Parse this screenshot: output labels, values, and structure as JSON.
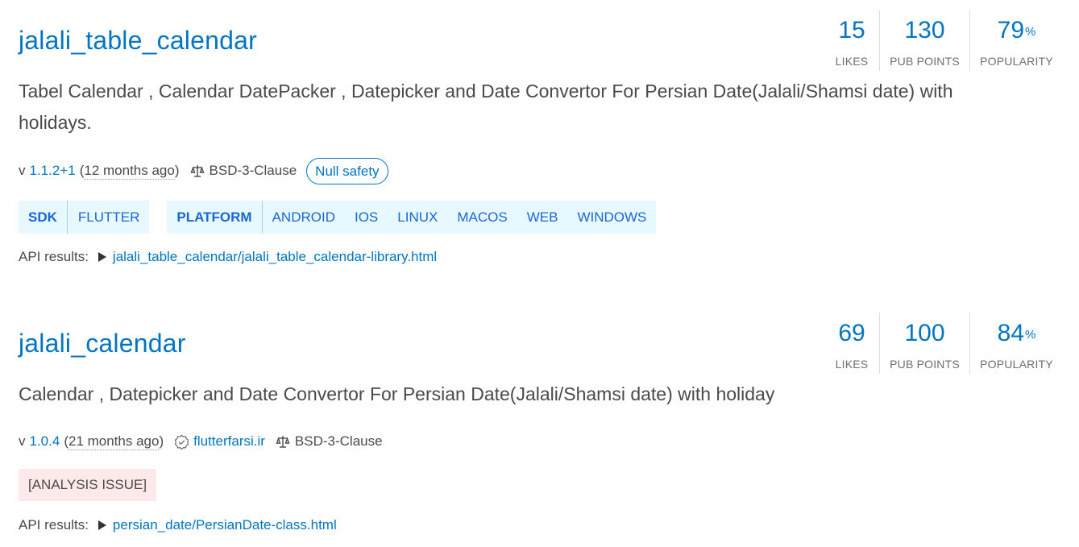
{
  "packages": [
    {
      "name": "jalali_table_calendar",
      "likes": "15",
      "points": "130",
      "popularity": "79",
      "likes_label": "LIKES",
      "points_label": "PUB POINTS",
      "popularity_label": "POPULARITY",
      "pct_symbol": "%",
      "description": "Tabel Calendar , Calendar DatePacker , Datepicker and Date Convertor For Persian Date(Jalali/Shamsi date) with holidays.",
      "version_prefix": "v",
      "version": "1.1.2+1",
      "ago": "12 months ago",
      "license": "BSD-3-Clause",
      "null_safety": "Null safety",
      "sdk_head": "SDK",
      "sdk_items": [
        "FLUTTER"
      ],
      "platform_head": "PLATFORM",
      "platform_items": [
        "ANDROID",
        "IOS",
        "LINUX",
        "MACOS",
        "WEB",
        "WINDOWS"
      ],
      "api_label": "API results:",
      "api_link": "jalali_table_calendar/jalali_table_calendar-library.html"
    },
    {
      "name": "jalali_calendar",
      "likes": "69",
      "points": "100",
      "popularity": "84",
      "likes_label": "LIKES",
      "points_label": "PUB POINTS",
      "popularity_label": "POPULARITY",
      "pct_symbol": "%",
      "description": "Calendar , Datepicker and Date Convertor For Persian Date(Jalali/Shamsi date) with holiday",
      "version_prefix": "v",
      "version": "1.0.4",
      "ago": "21 months ago",
      "publisher": "flutterfarsi.ir",
      "license": "BSD-3-Clause",
      "analysis_issue": "[ANALYSIS ISSUE]",
      "api_label": "API results:",
      "api_link": "persian_date/PersianDate-class.html"
    }
  ],
  "colors": {
    "link": "#0175c2",
    "tag_bg": "#e7f8ff",
    "tag_text": "#1967d2",
    "issue_bg": "#fde9e9"
  },
  "icons": [
    "law-icon",
    "verified-icon",
    "triangle-right-icon"
  ]
}
